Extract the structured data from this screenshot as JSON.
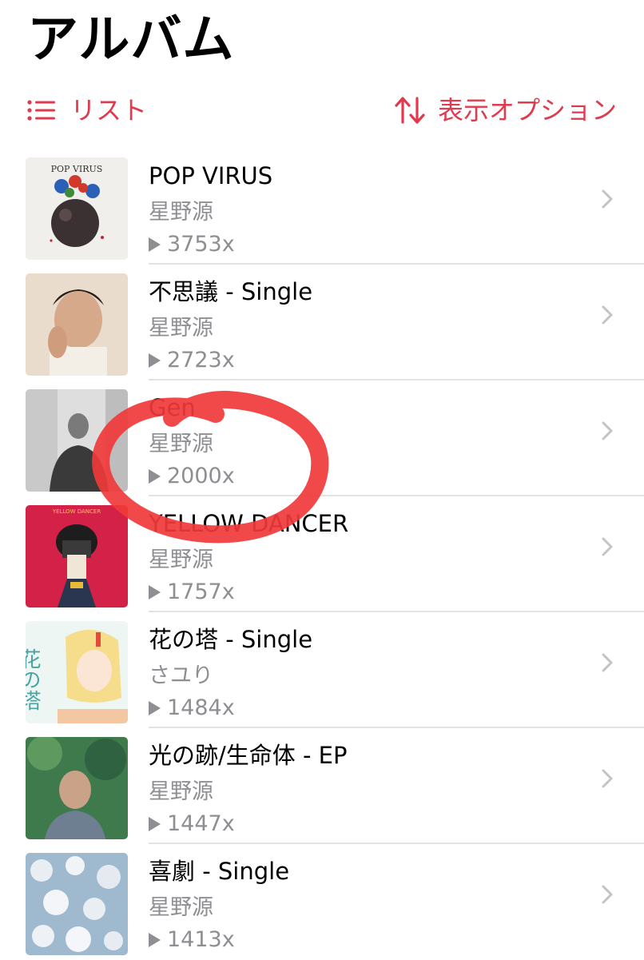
{
  "header": {
    "title": "アルバム"
  },
  "toolbar": {
    "list_label": "リスト",
    "options_label": "表示オプション"
  },
  "accent_color": "#E03A4E",
  "secondary_text_color": "#8E8E93",
  "albums": [
    {
      "title": "POP VIRUS",
      "artist": "星野源",
      "plays": "3753x",
      "art_text": "POP VIRUS"
    },
    {
      "title": "不思議 - Single",
      "artist": "星野源",
      "plays": "2723x"
    },
    {
      "title": "Gen",
      "artist": "星野源",
      "plays": "2000x"
    },
    {
      "title": "YELLOW DANCER",
      "artist": "星野源",
      "plays": "1757x",
      "art_text": "YELLOW DANCER"
    },
    {
      "title": "花の塔 - Single",
      "artist": "さユり",
      "plays": "1484x",
      "art_text": "花の塔"
    },
    {
      "title": "光の跡/生命体 - EP",
      "artist": "星野源",
      "plays": "1447x"
    },
    {
      "title": "喜劇 - Single",
      "artist": "星野源",
      "plays": "1413x"
    }
  ]
}
